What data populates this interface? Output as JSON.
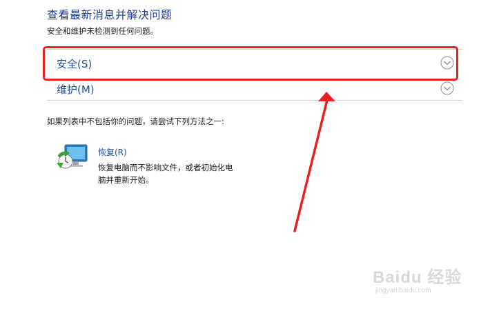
{
  "header": {
    "title": "查看最新消息并解决问题",
    "subtitle": "安全和维护未检测到任何问题。"
  },
  "sections": [
    {
      "label": "安全(S)",
      "icon": "chevron-down-icon"
    },
    {
      "label": "维护(M)",
      "icon": "chevron-down-icon"
    }
  ],
  "prompt": "如果列表中不包括你的问题，请尝试下列方法之一:",
  "recovery": {
    "link_label": "恢复(R)",
    "description": "恢复电脑而不影响文件，或者初始化电脑并重新开始。",
    "icon": "recovery-icon"
  },
  "watermark": {
    "text": "Baidu 经验",
    "sub": "jingyan.baidu.com"
  },
  "colors": {
    "highlight": "#e8201f",
    "link": "#1e4b9e",
    "title": "#1e3a8a"
  }
}
